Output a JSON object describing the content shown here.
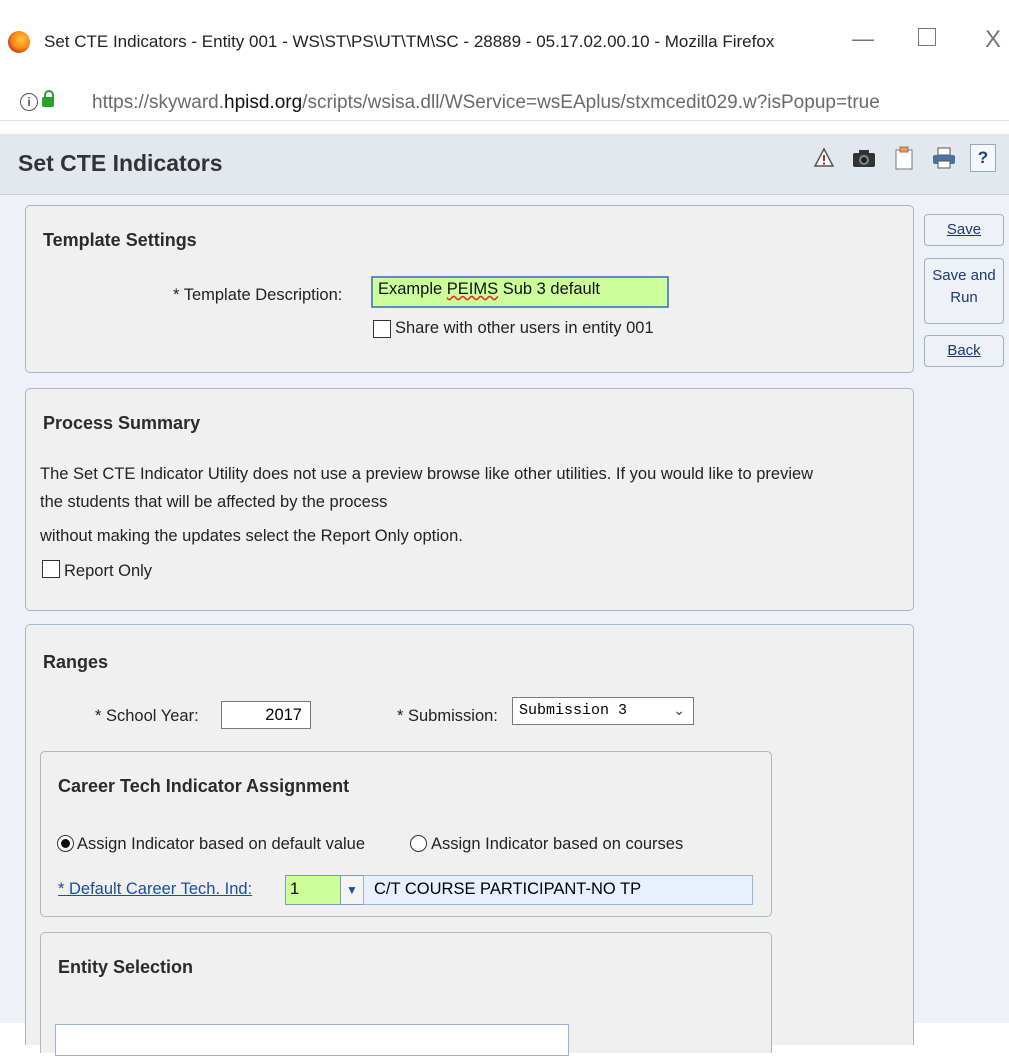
{
  "window": {
    "title": "Set CTE Indicators - Entity 001 - WS\\ST\\PS\\UT\\TM\\SC - 28889 - 05.17.02.00.10 - Mozilla Firefox",
    "minimize": "—",
    "close": "X"
  },
  "url": {
    "prefix": "https://skyward.",
    "domain": "hpisd.org",
    "suffix": "/scripts/wsisa.dll/WService=wsEAplus/stxmcedit029.w?isPopup=true"
  },
  "header": {
    "title": "Set CTE Indicators",
    "help": "?"
  },
  "actions": {
    "save": "Save",
    "save_and_run_1": "Save and",
    "save_and_run_2": "Run",
    "back": "Back"
  },
  "template_settings": {
    "title": "Template Settings",
    "description_label": "* Template Description:",
    "description_value_1": "Example ",
    "description_value_2": "PEIMS",
    "description_value_3": " Sub 3 default",
    "share_label": "Share with other users in entity 001",
    "share_checked": false
  },
  "process_summary": {
    "title": "Process Summary",
    "line1": "The Set CTE Indicator Utility does not use a preview browse like other utilities. If you would like to preview",
    "line2": "the students that will be affected by the process",
    "line3": "without making the updates select the Report Only option.",
    "report_only_label": "Report Only",
    "report_only_checked": false
  },
  "ranges": {
    "title": "Ranges",
    "school_year_label": "* School Year:",
    "school_year_value": "2017",
    "submission_label": "* Submission:",
    "submission_value": "Submission 3"
  },
  "career_tech": {
    "title": "Career Tech Indicator Assignment",
    "option_default": "Assign Indicator based on default value",
    "option_courses": "Assign Indicator based on courses",
    "selected_option": "default",
    "default_ind_label": "* Default Career Tech. Ind:",
    "default_ind_value": "1",
    "default_ind_desc": "C/T COURSE PARTICIPANT-NO TP"
  },
  "entity_selection": {
    "title": "Entity Selection"
  }
}
